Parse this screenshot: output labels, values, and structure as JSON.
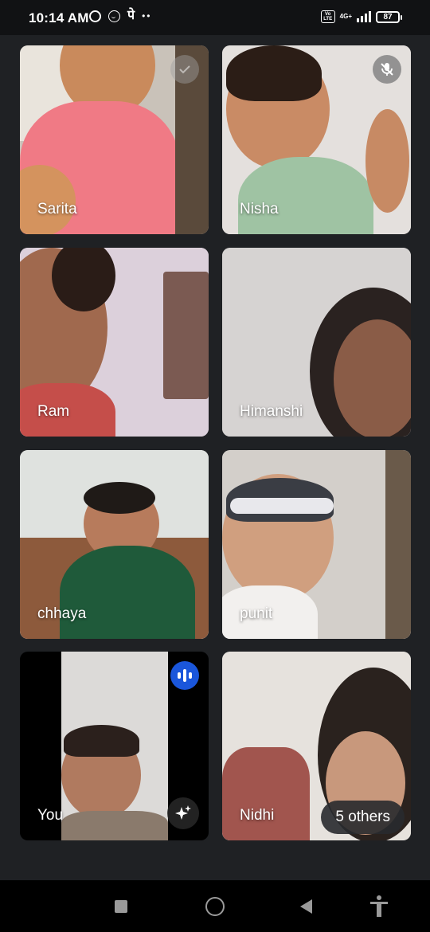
{
  "status_bar": {
    "time": "10:14 AM",
    "pe_glyph": "पे",
    "volte": "Vo LTE",
    "network": "4G+",
    "battery": "87"
  },
  "tiles": [
    {
      "name": "Sarita",
      "muted": true
    },
    {
      "name": "Nisha",
      "muted": true
    },
    {
      "name": "Ram"
    },
    {
      "name": "Himanshi"
    },
    {
      "name": "chhaya"
    },
    {
      "name": "punit"
    },
    {
      "name": "You",
      "speaking": true
    },
    {
      "name": "Nidhi"
    }
  ],
  "others_label": "5 others",
  "colors": {
    "background": "#1f2124",
    "speaking_badge": "#1a56db",
    "nav_icons": "#9a9a9a"
  },
  "icons": {
    "muted": "mic-off-icon",
    "speaking": "audio-level-icon",
    "effects": "sparkle-icon"
  }
}
